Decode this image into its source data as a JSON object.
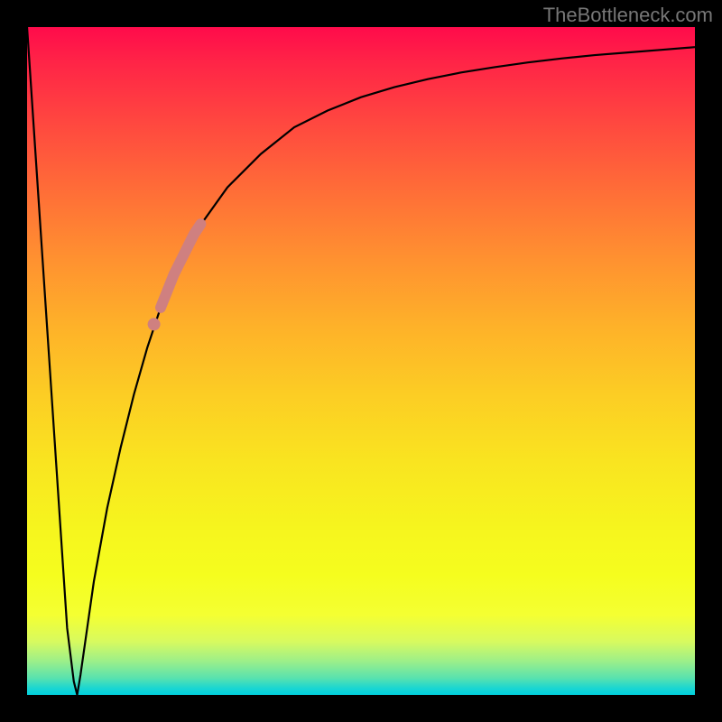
{
  "watermark": "TheBottleneck.com",
  "chart_data": {
    "type": "line",
    "title": "",
    "xlabel": "",
    "ylabel": "",
    "xlim": [
      0,
      100
    ],
    "ylim": [
      0,
      100
    ],
    "grid": false,
    "series": [
      {
        "name": "bottleneck-curve",
        "x": [
          0,
          1,
          2,
          3,
          4,
          5,
          6,
          7,
          7.5,
          8,
          9,
          10,
          12,
          14,
          16,
          18,
          20,
          22,
          25,
          30,
          35,
          40,
          45,
          50,
          55,
          60,
          65,
          70,
          75,
          80,
          85,
          90,
          95,
          100
        ],
        "values": [
          100,
          85,
          70,
          55,
          40,
          25,
          10,
          2,
          0,
          3,
          10,
          17,
          28,
          37,
          45,
          52,
          58,
          63,
          69,
          76,
          81,
          85,
          87.5,
          89.5,
          91,
          92.2,
          93.2,
          94,
          94.7,
          95.3,
          95.8,
          96.2,
          96.6,
          97
        ]
      }
    ],
    "highlight": {
      "name": "highlight-segment",
      "x": [
        20,
        21,
        22,
        23,
        24,
        25,
        26
      ],
      "values": [
        58,
        60.5,
        63,
        65,
        67,
        69,
        70.5
      ]
    },
    "highlight_dot": {
      "x": 19,
      "value": 55.5
    },
    "background_gradient": {
      "top": "#ff0b4b",
      "mid_upper": "#ff9230",
      "mid": "#f9e420",
      "mid_lower": "#f4ff32",
      "bottom": "#00d1dd"
    }
  }
}
